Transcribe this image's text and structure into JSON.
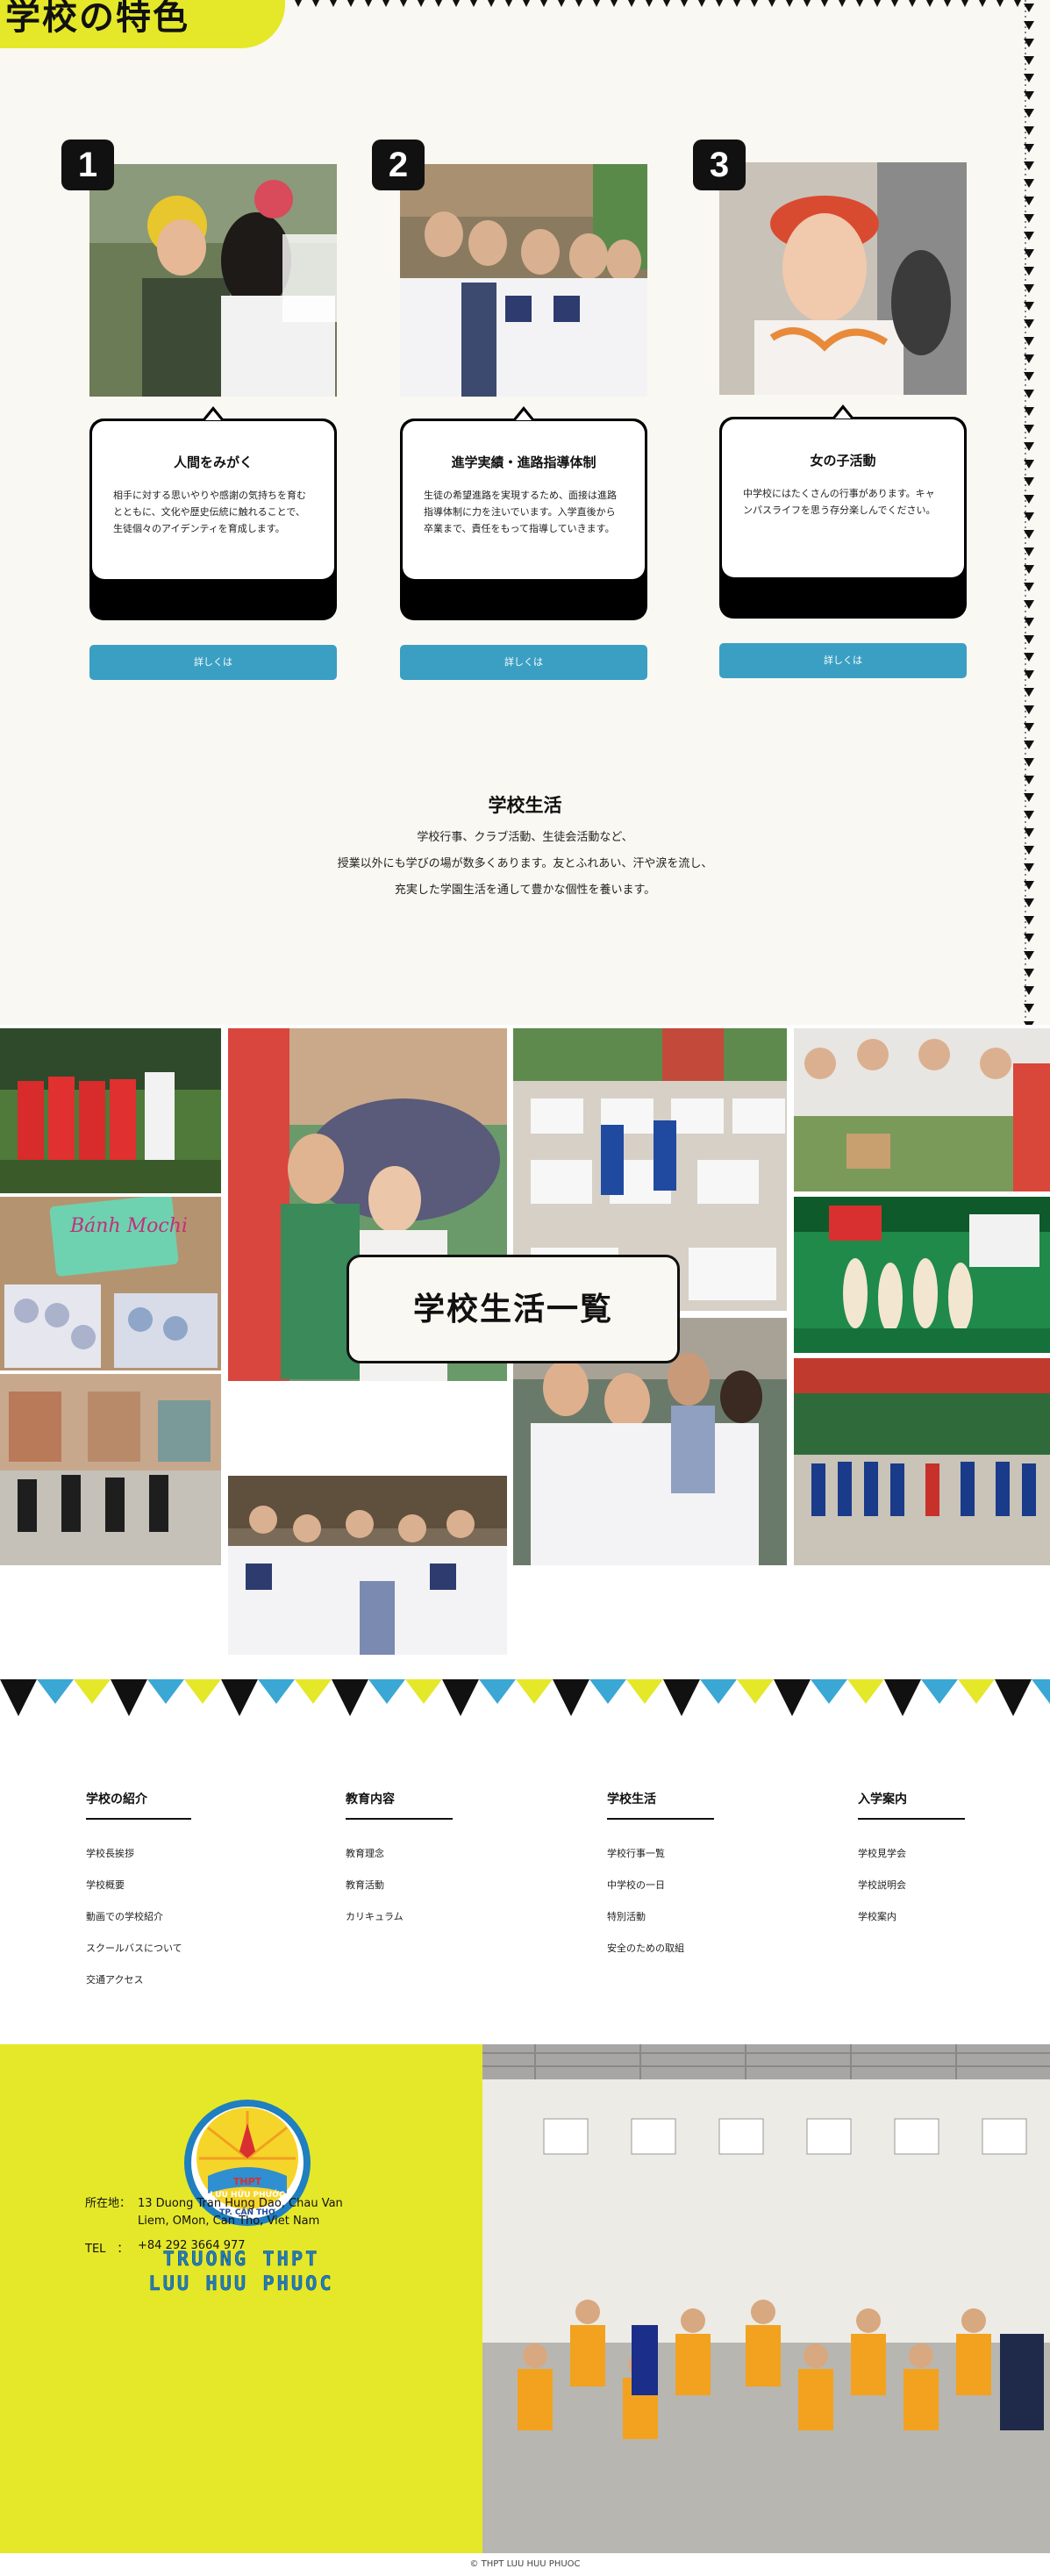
{
  "header": {
    "section_title_fragment": "学校の特色"
  },
  "features": [
    {
      "number": "1",
      "title": "人間をみがく",
      "text": "相手に対する思いやりや感謝の気持ちを育むとともに、文化や歴史伝統に触れることで、生徒個々のアイデンティを育成します。",
      "button": "詳しくは"
    },
    {
      "number": "2",
      "title": "進学実績・進路指導体制",
      "text": "生徒の希望進路を実現するため、面接は進路指導体制に力を注いでいます。入学直後から卒業まで、責任をもって指導していきます。",
      "button": "詳しくは"
    },
    {
      "number": "3",
      "title": "女の子活動",
      "text": "中学校にはたくさんの行事があります。キャンパスライフを思う存分楽しんでください。",
      "button": "詳しくは"
    }
  ],
  "school_life": {
    "title": "学校生活",
    "lines": [
      "学校行事、クラブ活動、生徒会活動など、",
      "授業以外にも学びの場が数多くあります。友とふれあい、汗や涙を流し、",
      "充実した学園生活を通して豊かな個性を養います。"
    ],
    "gallery_button": "学校生活一覧",
    "banner_text": "Bánh Mochi"
  },
  "footer_nav": [
    {
      "heading": "学校の紹介",
      "items": [
        "学校長挨拶",
        "学校概要",
        "動画での学校紹介",
        "スクールバスについて",
        "交通アクセス"
      ]
    },
    {
      "heading": "教育内容",
      "items": [
        "教育理念",
        "教育活動",
        "カリキュラム"
      ]
    },
    {
      "heading": "学校生活",
      "items": [
        "学校行事一覧",
        "中学校の一日",
        "特別活動",
        "安全のための取組"
      ]
    },
    {
      "heading": "入学案内",
      "items": [
        "学校見学会",
        "学校説明会",
        "学校案内"
      ]
    }
  ],
  "footer": {
    "logo_top": "THPT",
    "logo_mid": "LƯU HỮU PHƯỚC",
    "logo_bottom": "TP. CẦN THƠ",
    "school_name_line1": "TRUONG THPT",
    "school_name_line2": "LUU HUU PHUOC",
    "address_label": "所在地：",
    "address_line1": "13 Duong Tran Hung Dao, Chau Van",
    "address_line2": "Liem, OMon, Can Tho, Viet Nam",
    "tel_label": "TEL　：",
    "tel_value": "+84 292 3664 977",
    "copyright": "© THPT LUU HUU PHUOC"
  },
  "colors": {
    "accent_yellow": "#e5e829",
    "button_blue": "#3a9fc3",
    "cream": "#faf8f2",
    "dark": "#111111"
  }
}
